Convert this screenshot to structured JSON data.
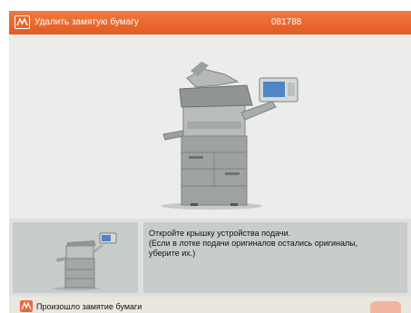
{
  "titlebar": {
    "title": "Удалить замятую бумагу",
    "code": "081788"
  },
  "instruction": {
    "lines": [
      "Откройте крышку устройства подачи.",
      "(Если в лотке подачи оригиналов остались оригиналы,",
      "уберите их.)"
    ]
  },
  "statusbar": {
    "message": "Произошло замятие бумаги"
  },
  "colors": {
    "titlebar": "#e8662e",
    "panel": "#c9cdca",
    "background": "#ececeb"
  }
}
